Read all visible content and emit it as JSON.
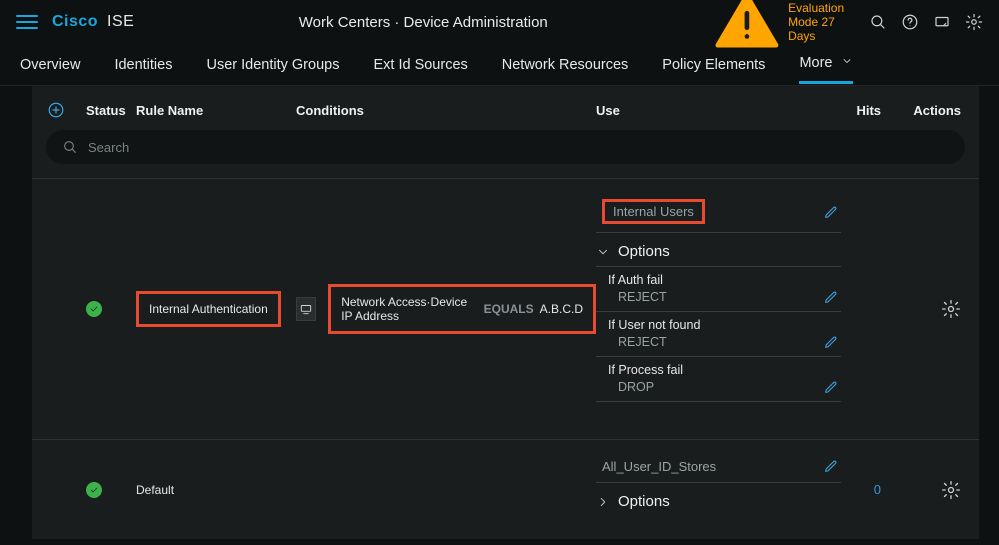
{
  "brand": {
    "part1": "Cisco",
    "part2": "ISE"
  },
  "breadcrumb": "Work Centers · Device Administration",
  "eval_label": "Evaluation Mode 27 Days",
  "nav": {
    "items": [
      {
        "label": "Overview"
      },
      {
        "label": "Identities"
      },
      {
        "label": "User Identity Groups"
      },
      {
        "label": "Ext Id Sources"
      },
      {
        "label": "Network Resources"
      },
      {
        "label": "Policy Elements"
      },
      {
        "label": "More",
        "active": true
      }
    ]
  },
  "columns": {
    "status": "Status",
    "rule_name": "Rule Name",
    "conditions": "Conditions",
    "use": "Use",
    "hits": "Hits",
    "actions": "Actions"
  },
  "search": {
    "placeholder": "Search"
  },
  "rules": {
    "main": {
      "name": "Internal Authentication",
      "condition": {
        "attr": "Network Access·Device IP Address",
        "op": "EQUALS",
        "val": "A.B.C.D"
      },
      "use": {
        "identity_source": "Internal Users",
        "options_label": "Options",
        "items": [
          {
            "k": "If Auth fail",
            "v": "REJECT"
          },
          {
            "k": "If User not found",
            "v": "REJECT"
          },
          {
            "k": "If Process fail",
            "v": "DROP"
          }
        ]
      }
    },
    "default": {
      "name": "Default",
      "use": {
        "identity_source": "All_User_ID_Stores",
        "options_label": "Options"
      },
      "hits": "0"
    }
  }
}
